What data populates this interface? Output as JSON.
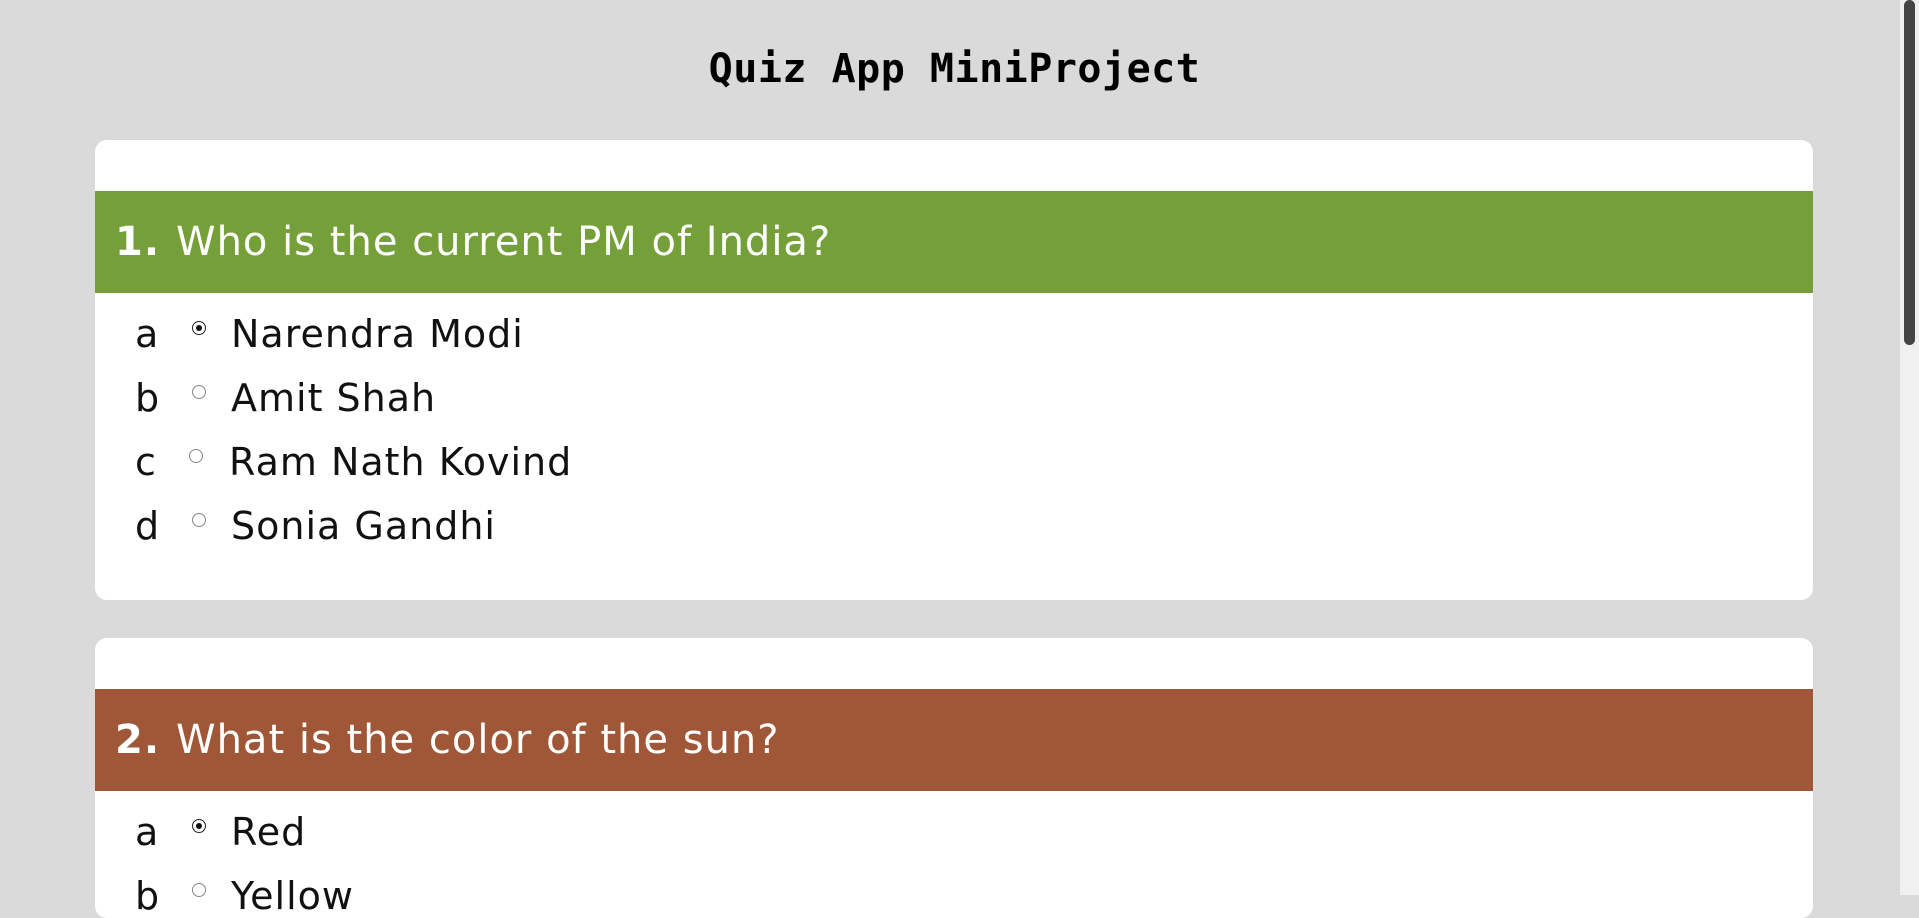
{
  "page": {
    "title": "Quiz App MiniProject"
  },
  "questions": [
    {
      "number": "1.",
      "text": "Who is the current PM of India?",
      "bar_color": "#75a039",
      "options": [
        {
          "letter": "a",
          "label": "Narendra Modi",
          "checked": true
        },
        {
          "letter": "b",
          "label": "Amit Shah",
          "checked": false
        },
        {
          "letter": "c",
          "label": "Ram Nath Kovind",
          "checked": false
        },
        {
          "letter": "d",
          "label": "Sonia Gandhi",
          "checked": false
        }
      ]
    },
    {
      "number": "2.",
      "text": "What is the color of the sun?",
      "bar_color": "#a05738",
      "options": [
        {
          "letter": "a",
          "label": "Red",
          "checked": true
        },
        {
          "letter": "b",
          "label": "Yellow",
          "checked": false
        }
      ]
    }
  ],
  "colors": {
    "page_background": "#dadada",
    "card_background": "#ffffff"
  }
}
